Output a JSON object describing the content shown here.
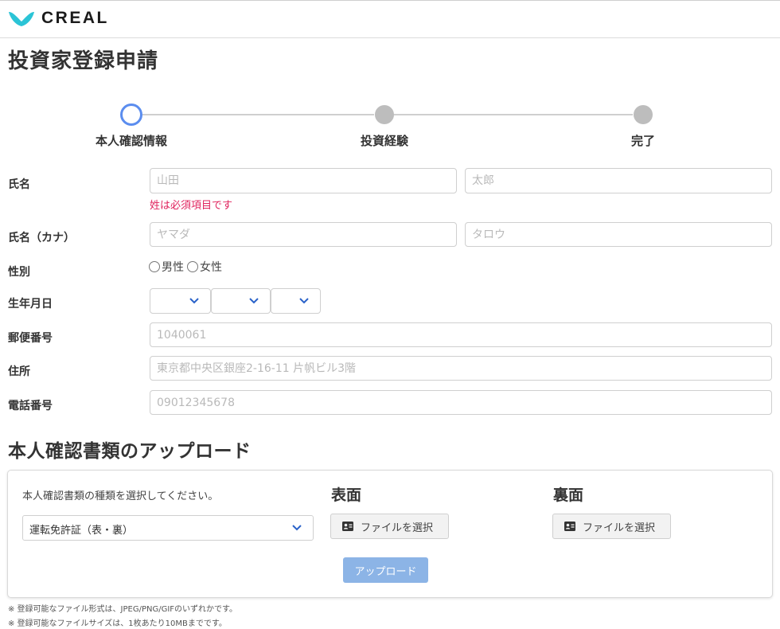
{
  "brand": {
    "name": "CREAL",
    "color": "#2bc4d6"
  },
  "page_title": "投資家登録申請",
  "stepper": {
    "steps": [
      {
        "label": "本人確認情報",
        "state": "active"
      },
      {
        "label": "投資経験",
        "state": "pending"
      },
      {
        "label": "完了",
        "state": "pending"
      }
    ],
    "active_color": "#5b8def",
    "pending_color": "#bdbdbd"
  },
  "form": {
    "name": {
      "label": "氏名",
      "last_placeholder": "山田",
      "first_placeholder": "太郎",
      "last_value": "",
      "first_value": "",
      "error": "姓は必須項目です"
    },
    "kana": {
      "label": "氏名（カナ）",
      "last_placeholder": "ヤマダ",
      "first_placeholder": "タロウ",
      "last_value": "",
      "first_value": ""
    },
    "gender": {
      "label": "性別",
      "options": [
        "男性",
        "女性"
      ],
      "selected": null
    },
    "birthdate": {
      "label": "生年月日",
      "year": "",
      "month": "",
      "day": ""
    },
    "postal": {
      "label": "郵便番号",
      "placeholder": "1040061",
      "value": ""
    },
    "address": {
      "label": "住所",
      "placeholder": "東京都中央区銀座2-16-11 片帆ビル3階",
      "value": ""
    },
    "phone": {
      "label": "電話番号",
      "placeholder": "09012345678",
      "value": ""
    }
  },
  "upload": {
    "section_title": "本人確認書類のアップロード",
    "instruction": "本人確認書類の種類を選択してください。",
    "document_type": "運転免許証（表・裏）",
    "front_title": "表面",
    "back_title": "裏面",
    "file_button_label": "ファイルを選択",
    "upload_button_label": "アップロード",
    "upload_button_color": "#8cb4e6"
  },
  "notes": [
    "※ 登録可能なファイル形式は、JPEG/PNG/GIFのいずれかです。",
    "※ 登録可能なファイルサイズは、1枚あたり10MBまでです。"
  ],
  "error_color": "#e0245e",
  "chevron_color": "#2a62c9"
}
